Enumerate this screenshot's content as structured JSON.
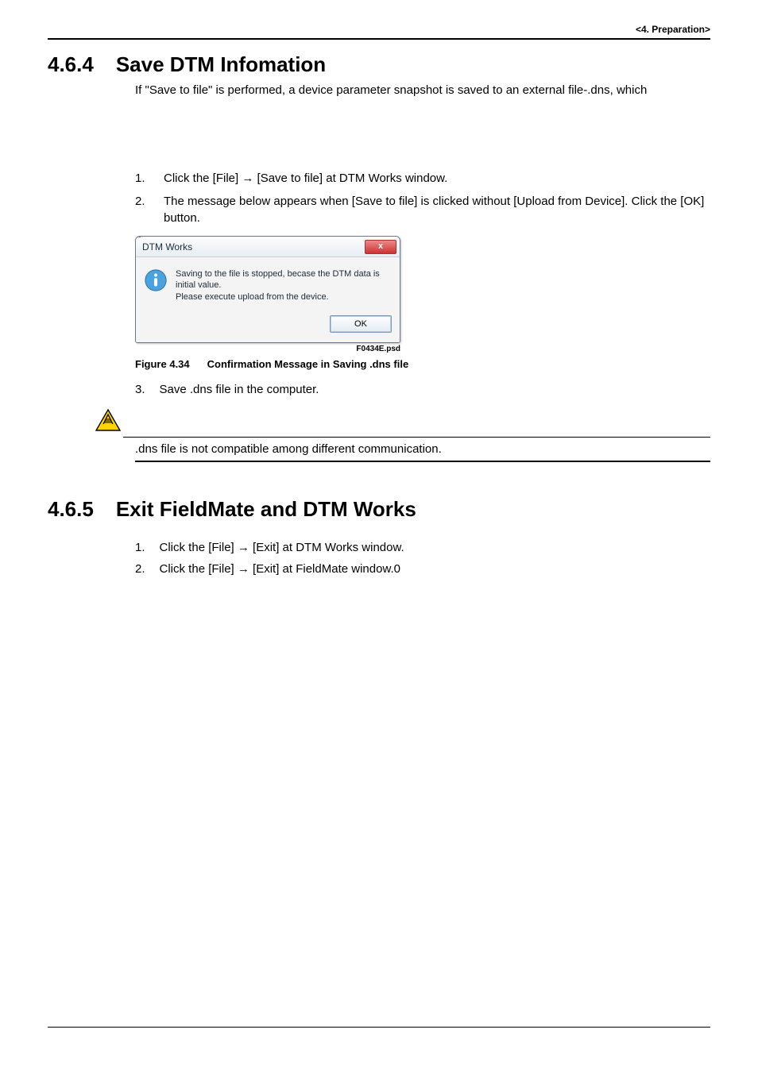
{
  "header": {
    "breadcrumb": "<4.  Preparation>"
  },
  "section1": {
    "number": "4.6.4",
    "title": "Save DTM Infomation",
    "intro": "If \"Save to file\" is performed, a device parameter snapshot is saved to an external file-.dns, which",
    "steps": [
      {
        "n": "1.",
        "t": "Click the [File] → [Save to file] at DTM Works window."
      },
      {
        "n": "2.",
        "t": "The message below appears when [Save to file] is clicked without [Upload from Device]. Click the [OK] button."
      }
    ],
    "dialog": {
      "title": "DTM Works",
      "close_glyph": "x",
      "msg_line1": "Saving to the file is stopped, becase the DTM data is initial value.",
      "msg_line2": "Please execute upload from the device.",
      "ok_label": "OK",
      "img_id": "F0434E.psd"
    },
    "figure": {
      "num": "Figure 4.34",
      "caption": "Confirmation Message in Saving .dns file"
    },
    "step3": {
      "n": "3.",
      "t": "Save .dns file in the computer."
    },
    "warning": ".dns file is not compatible among different communication."
  },
  "section2": {
    "number": "4.6.5",
    "title": "Exit FieldMate and DTM Works",
    "steps": [
      {
        "n": "1.",
        "t": "Click the [File] → [Exit] at DTM Works window."
      },
      {
        "n": "2.",
        "t": "Click the [File] → [Exit] at FieldMate window.0"
      }
    ]
  }
}
